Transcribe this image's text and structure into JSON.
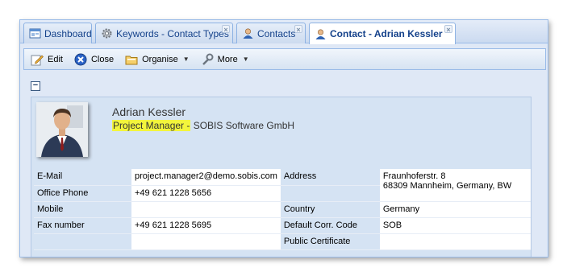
{
  "tabs": [
    {
      "label": "Dashboard",
      "icon": "dashboard-icon",
      "closable": false
    },
    {
      "label": "Keywords - Contact Types",
      "icon": "gear-icon",
      "closable": true
    },
    {
      "label": "Contacts",
      "icon": "user-icon",
      "closable": true
    },
    {
      "label": "Contact - Adrian Kessler",
      "icon": "user-icon",
      "closable": true,
      "active": true
    }
  ],
  "toolbar": {
    "edit": "Edit",
    "close": "Close",
    "organise": "Organise",
    "more": "More"
  },
  "contact": {
    "name": "Adrian Kessler",
    "role": "Project Manager -",
    "company": "SOBIS Software GmbH"
  },
  "fields": {
    "email_label": "E-Mail",
    "email_value": "project.manager2@demo.sobis.com",
    "office_phone_label": "Office Phone",
    "office_phone_value": "+49 621 1228 5656",
    "mobile_label": "Mobile",
    "mobile_value": "",
    "fax_label": "Fax number",
    "fax_value": "+49 621 1228 5695",
    "address_label": "Address",
    "address_line1": "Fraunhoferstr. 8",
    "address_line2": "68309 Mannheim, Germany, BW",
    "country_label": "Country",
    "country_value": "Germany",
    "corr_code_label": "Default Corr. Code",
    "corr_code_value": "SOB",
    "certificate_label": "Public Certificate",
    "certificate_value": ""
  },
  "colors": {
    "highlight": "#f3f53c",
    "panel_bg": "#d5e3f3",
    "tab_text": "#15428b"
  }
}
